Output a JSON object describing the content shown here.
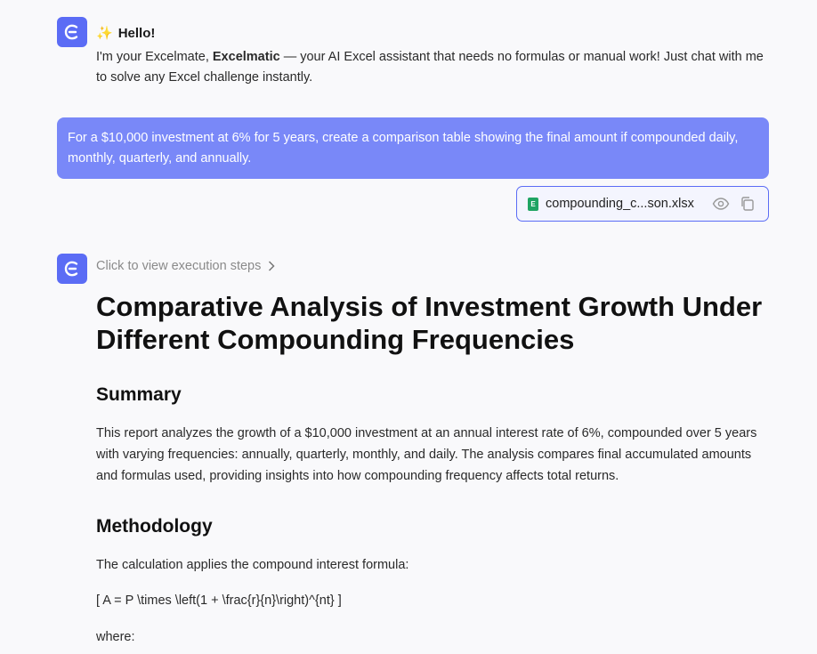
{
  "assistant": {
    "hello_emoji": "✨",
    "hello": "Hello!",
    "intro_prefix": "I'm your Excelmate, ",
    "intro_brand": "Excelmatic",
    "intro_suffix": " — your AI Excel assistant that needs no formulas or manual work! Just chat with me to solve any Excel challenge instantly."
  },
  "user_message": "For a $10,000 investment at 6% for 5 years, create a comparison table showing the final amount if compounded daily, monthly, quarterly, and annually.",
  "attachment": {
    "icon_letter": "E",
    "filename": "compounding_c...son.xlsx",
    "preview_icon": "eye-icon",
    "copy_icon": "copy-icon"
  },
  "response": {
    "steps_link": "Click to view execution steps",
    "title": "Comparative Analysis of Investment Growth Under Different Compounding Frequencies",
    "summary_heading": "Summary",
    "summary_text": "This report analyzes the growth of a $10,000 investment at an annual interest rate of 6%, compounded over 5 years with varying frequencies: annually, quarterly, monthly, and daily. The analysis compares final accumulated amounts and formulas used, providing insights into how compounding frequency affects total returns.",
    "methodology_heading": "Methodology",
    "methodology_text": "The calculation applies the compound interest formula:",
    "formula": "[ A = P \\times \\left(1 + \\frac{r}{n}\\right)^{nt} ]",
    "where": "where:"
  },
  "colors": {
    "brand": "#5b6cf5",
    "user_bubble": "#7988f8",
    "excel_green": "#1fa463"
  }
}
